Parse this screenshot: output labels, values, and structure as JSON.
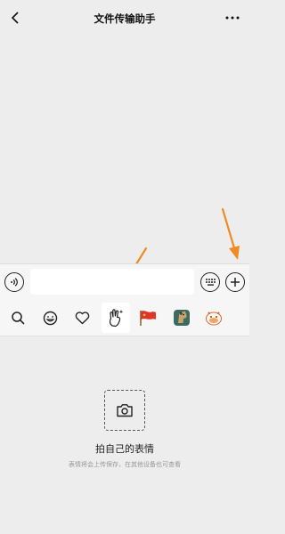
{
  "navbar": {
    "title": "文件传输助手",
    "back_icon": "chevron-left-icon",
    "more_icon": "ellipsis-icon"
  },
  "input_bar": {
    "voice_icon": "voice-icon",
    "text_value": "",
    "keyboard_icon": "keyboard-icon",
    "plus_icon": "plus-icon"
  },
  "sticker_tabs": [
    {
      "icon": "search-icon",
      "selected": false
    },
    {
      "icon": "emoji-icon",
      "selected": false
    },
    {
      "icon": "heart-icon",
      "selected": false
    },
    {
      "icon": "hand-gesture-icon",
      "selected": true
    },
    {
      "icon": "red-flag-sticker-icon",
      "selected": false
    },
    {
      "icon": "horse-sticker-icon",
      "selected": false
    },
    {
      "icon": "cartoon-sticker-icon",
      "selected": false
    }
  ],
  "panel": {
    "camera_icon": "camera-icon",
    "title": "拍自己的表情",
    "subtitle": "表情将会上传保存，在其他设备也可查看"
  },
  "colors": {
    "background": "#ededed",
    "bar": "#f6f6f6",
    "arrow": "#f08a24",
    "flag_red": "#e0352b"
  }
}
